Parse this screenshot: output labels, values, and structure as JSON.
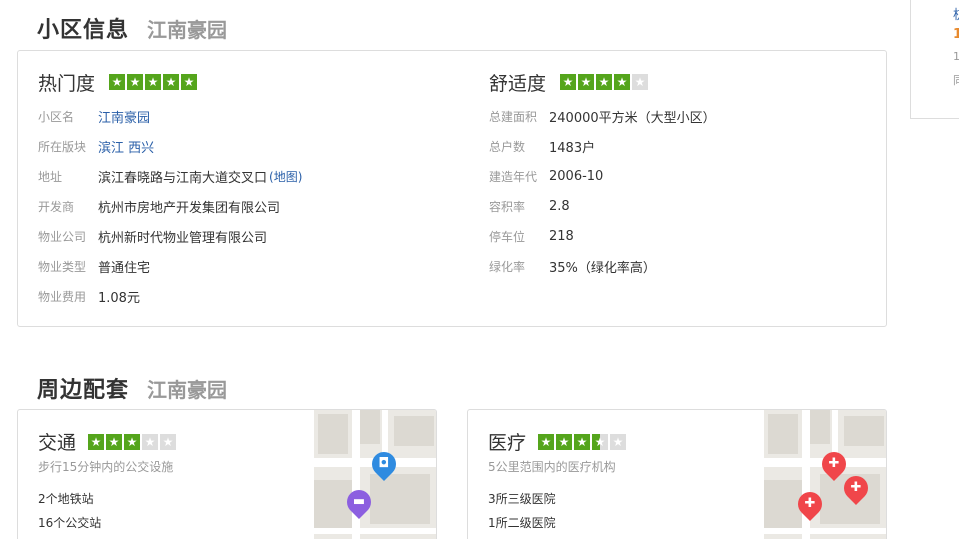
{
  "community": {
    "title": "小区信息",
    "subtitle": "江南豪园",
    "left": {
      "heading": "热门度",
      "rating": 5,
      "rows": [
        {
          "label": "小区名",
          "value": "江南豪园",
          "link": true
        },
        {
          "label": "所在版块",
          "value": "滨江 西兴",
          "link": true
        },
        {
          "label": "地址",
          "value": "滨江春晓路与江南大道交叉口",
          "map": "(地图)"
        },
        {
          "label": "开发商",
          "value": "杭州市房地产开发集团有限公司"
        },
        {
          "label": "物业公司",
          "value": "杭州新时代物业管理有限公司"
        },
        {
          "label": "物业类型",
          "value": "普通住宅"
        },
        {
          "label": "物业费用",
          "value": "1.08元"
        }
      ]
    },
    "right": {
      "heading": "舒适度",
      "rating": 4,
      "rows": [
        {
          "label": "总建面积",
          "value": "240000平方米（大型小区）"
        },
        {
          "label": "总户数",
          "value": "1483户"
        },
        {
          "label": "建造年代",
          "value": "2006-10"
        },
        {
          "label": "容积率",
          "value": "2.8"
        },
        {
          "label": "停车位",
          "value": "218"
        },
        {
          "label": "绿化率",
          "value": "35%（绿化率高）"
        }
      ]
    }
  },
  "surroundings": {
    "title": "周边配套",
    "subtitle": "江南豪园",
    "transport": {
      "heading": "交通",
      "rating": 3,
      "desc": "步行15分钟内的公交设施",
      "lines": [
        "2个地铁站",
        "16个公交站"
      ]
    },
    "medical": {
      "heading": "医疗",
      "rating": 3.5,
      "desc": "5公里范围内的医疗机构",
      "lines": [
        "3所三级医院",
        "1所二级医院"
      ]
    }
  },
  "right_fragment": {
    "a": "杭",
    "b": "1",
    "c": "1",
    "d": "同"
  },
  "colors": {
    "star": "#55a51c",
    "link": "#2a5fa8",
    "accent": "#e88a2e"
  }
}
